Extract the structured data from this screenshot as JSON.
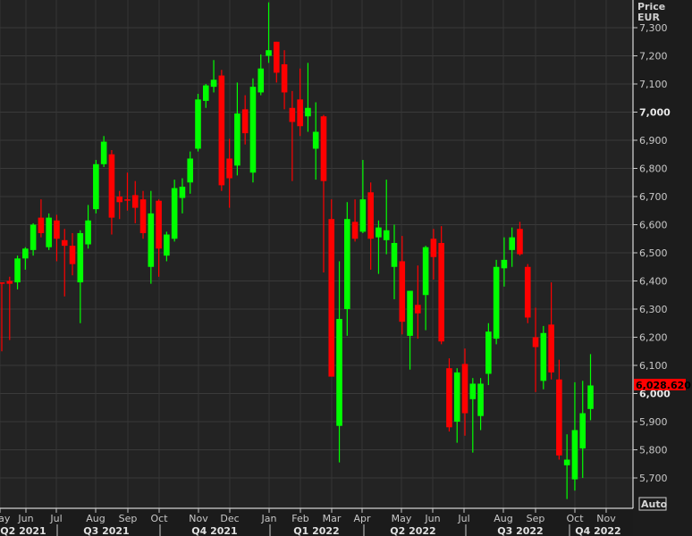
{
  "chart_data": {
    "type": "candlestick",
    "title": "",
    "y_axis": {
      "label_line1": "Price",
      "label_line2": "EUR",
      "ylim": [
        5600,
        7400
      ],
      "ticks": [
        "7,300",
        "7,200",
        "7,100",
        "7,000",
        "6,900",
        "6,800",
        "6,700",
        "6,600",
        "6,500",
        "6,400",
        "6,300",
        "6,200",
        "6,100",
        "6,000",
        "5,900",
        "5,800",
        "5,700"
      ],
      "tick_values": [
        7300,
        7200,
        7100,
        7000,
        6900,
        6800,
        6700,
        6600,
        6500,
        6400,
        6300,
        6200,
        6100,
        6000,
        5900,
        5800,
        5700
      ],
      "position": "right"
    },
    "x_axis": {
      "months": [
        "May",
        "Jun",
        "Jul",
        "Aug",
        "Sep",
        "Oct",
        "Nov",
        "Dec",
        "Jan",
        "Feb",
        "Mar",
        "Apr",
        "May",
        "Jun",
        "Jul",
        "Aug",
        "Sep",
        "Oct",
        "Nov"
      ],
      "quarters": [
        "Q2 2021",
        "Q3 2021",
        "Q4 2021",
        "Q1 2022",
        "Q2 2022",
        "Q3 2022",
        "Q4 2022"
      ]
    },
    "grid": true,
    "last_price": "6,028.620",
    "colors": {
      "up": "#00ff00",
      "down": "#ff0000",
      "background": "#232323",
      "last_price_tag": "#ff0000"
    },
    "candles_ohlc": [
      [
        6395,
        6395,
        6150,
        6390
      ],
      [
        6400,
        6415,
        6190,
        6390
      ],
      [
        6395,
        6490,
        6370,
        6480
      ],
      [
        6480,
        6520,
        6440,
        6515
      ],
      [
        6510,
        6605,
        6490,
        6600
      ],
      [
        6625,
        6690,
        6555,
        6570
      ],
      [
        6520,
        6640,
        6510,
        6625
      ],
      [
        6615,
        6635,
        6470,
        6550
      ],
      [
        6545,
        6585,
        6345,
        6525
      ],
      [
        6525,
        6570,
        6420,
        6460
      ],
      [
        6395,
        6580,
        6250,
        6570
      ],
      [
        6530,
        6670,
        6515,
        6615
      ],
      [
        6655,
        6830,
        6640,
        6815
      ],
      [
        6815,
        6915,
        6805,
        6895
      ],
      [
        6850,
        6865,
        6565,
        6625
      ],
      [
        6700,
        6720,
        6620,
        6680
      ],
      [
        6690,
        6785,
        6650,
        6688
      ],
      [
        6705,
        6755,
        6605,
        6660
      ],
      [
        6690,
        6720,
        6550,
        6570
      ],
      [
        6450,
        6720,
        6390,
        6640
      ],
      [
        6685,
        6690,
        6415,
        6515
      ],
      [
        6490,
        6575,
        6470,
        6565
      ],
      [
        6550,
        6760,
        6540,
        6730
      ],
      [
        6695,
        6765,
        6640,
        6735
      ],
      [
        6750,
        6860,
        6710,
        6835
      ],
      [
        6870,
        7065,
        6860,
        7045
      ],
      [
        7040,
        7100,
        7015,
        7095
      ],
      [
        7090,
        7185,
        7070,
        7115
      ],
      [
        7130,
        7150,
        6720,
        6740
      ],
      [
        6835,
        6905,
        6660,
        6765
      ],
      [
        6810,
        7105,
        6775,
        6995
      ],
      [
        7010,
        7060,
        6885,
        6925
      ],
      [
        6785,
        7120,
        6750,
        7090
      ],
      [
        7070,
        7205,
        7060,
        7155
      ],
      [
        7200,
        7390,
        7175,
        7220
      ],
      [
        7250,
        7250,
        7105,
        7140
      ],
      [
        7170,
        7220,
        7010,
        7070
      ],
      [
        7015,
        7075,
        6755,
        6965
      ],
      [
        7045,
        7155,
        6915,
        6950
      ],
      [
        6985,
        7175,
        6930,
        7015
      ],
      [
        6870,
        7035,
        6760,
        6930
      ],
      [
        6985,
        6990,
        6430,
        6755
      ],
      [
        6620,
        6690,
        6060,
        6060
      ],
      [
        5885,
        6470,
        5755,
        6265
      ],
      [
        6300,
        6680,
        6205,
        6620
      ],
      [
        6610,
        6690,
        6540,
        6550
      ],
      [
        6575,
        6830,
        6570,
        6690
      ],
      [
        6715,
        6750,
        6440,
        6550
      ],
      [
        6555,
        6615,
        6425,
        6590
      ],
      [
        6545,
        6760,
        6495,
        6580
      ],
      [
        6450,
        6600,
        6335,
        6535
      ],
      [
        6470,
        6560,
        6210,
        6255
      ],
      [
        6205,
        6365,
        6085,
        6365
      ],
      [
        6315,
        6455,
        6195,
        6285
      ],
      [
        6350,
        6525,
        6225,
        6520
      ],
      [
        6550,
        6585,
        6405,
        6485
      ],
      [
        6535,
        6595,
        6175,
        6185
      ],
      [
        6090,
        6125,
        5865,
        5880
      ],
      [
        5900,
        6090,
        5825,
        6075
      ],
      [
        6105,
        6160,
        5850,
        5930
      ],
      [
        5980,
        6055,
        5790,
        6035
      ],
      [
        5920,
        6055,
        5870,
        6035
      ],
      [
        6070,
        6250,
        6030,
        6220
      ],
      [
        6195,
        6475,
        6175,
        6450
      ],
      [
        6445,
        6555,
        6380,
        6475
      ],
      [
        6510,
        6590,
        6450,
        6555
      ],
      [
        6585,
        6610,
        6490,
        6495
      ],
      [
        6450,
        6460,
        6250,
        6270
      ],
      [
        6200,
        6305,
        6005,
        6165
      ],
      [
        6045,
        6240,
        6015,
        6215
      ],
      [
        6245,
        6395,
        6050,
        6075
      ],
      [
        6050,
        6120,
        5765,
        5780
      ],
      [
        5745,
        5855,
        5625,
        5765
      ],
      [
        5695,
        6040,
        5655,
        5870
      ],
      [
        5805,
        6045,
        5700,
        5930
      ],
      [
        5945,
        6140,
        5905,
        6028.62
      ]
    ]
  },
  "controls": {
    "auto_label": "Auto"
  }
}
